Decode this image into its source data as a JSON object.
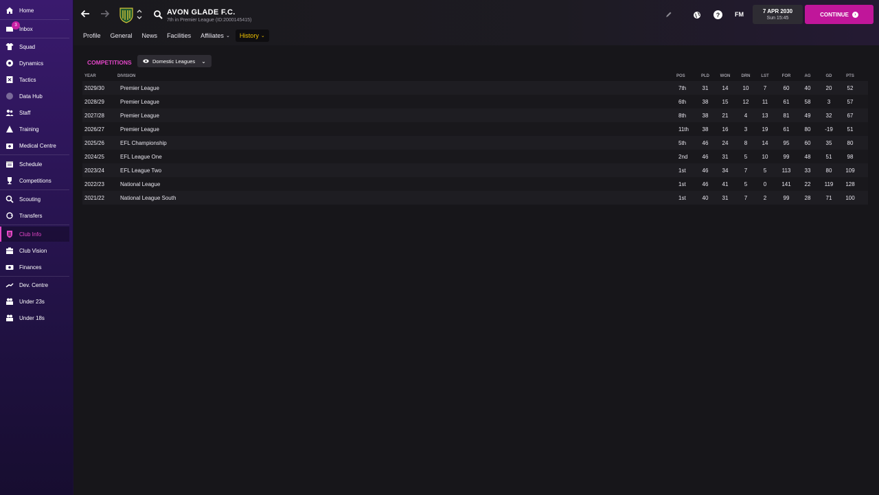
{
  "sidebar": {
    "items": [
      {
        "label": "Home",
        "icon": "home-icon"
      },
      {
        "label": "Inbox",
        "icon": "inbox-icon",
        "badge": "3"
      },
      {
        "label": "Squad",
        "icon": "shirt-icon"
      },
      {
        "label": "Dynamics",
        "icon": "dynamics-icon"
      },
      {
        "label": "Tactics",
        "icon": "tactics-icon"
      },
      {
        "label": "Data Hub",
        "icon": "data-hub-icon"
      },
      {
        "label": "Staff",
        "icon": "staff-icon"
      },
      {
        "label": "Training",
        "icon": "training-icon"
      },
      {
        "label": "Medical Centre",
        "icon": "medical-icon"
      },
      {
        "label": "Schedule",
        "icon": "calendar-icon"
      },
      {
        "label": "Competitions",
        "icon": "trophy-icon"
      },
      {
        "label": "Scouting",
        "icon": "scouting-icon"
      },
      {
        "label": "Transfers",
        "icon": "transfers-icon"
      },
      {
        "label": "Club Info",
        "icon": "club-shield-icon",
        "active": true
      },
      {
        "label": "Club Vision",
        "icon": "vision-icon"
      },
      {
        "label": "Finances",
        "icon": "finances-icon"
      },
      {
        "label": "Dev. Centre",
        "icon": "dev-centre-icon"
      },
      {
        "label": "Under 23s",
        "icon": "under23-icon"
      },
      {
        "label": "Under 18s",
        "icon": "under18-icon"
      }
    ]
  },
  "header": {
    "club_name": "AVON GLADE F.C.",
    "club_subtitle": "7th in Premier League (ID:2000145415)",
    "fm_logo": "FM",
    "help_glyph": "?",
    "date": "7 APR 2030",
    "time": "Sun 15:45",
    "continue_label": "CONTINUE"
  },
  "tabs": [
    {
      "label": "Profile"
    },
    {
      "label": "General"
    },
    {
      "label": "News"
    },
    {
      "label": "Facilities"
    },
    {
      "label": "Affiliates",
      "dropdown": true
    },
    {
      "label": "History",
      "dropdown": true,
      "active": true
    }
  ],
  "competitions": {
    "title": "COMPETITIONS",
    "filter_label": "Domestic Leagues"
  },
  "table": {
    "headers": {
      "year": "YEAR",
      "division": "DIVISION",
      "pos": "POS",
      "pld": "PLD",
      "won": "WON",
      "drn": "DRN",
      "lst": "LST",
      "for": "FOR",
      "ag": "AG",
      "gd": "GD",
      "pts": "PTS"
    },
    "rows": [
      {
        "year": "2029/30",
        "division": "Premier League",
        "pos": "7th",
        "pld": "31",
        "won": "14",
        "drn": "10",
        "lst": "7",
        "for": "60",
        "ag": "40",
        "gd": "20",
        "pts": "52"
      },
      {
        "year": "2028/29",
        "division": "Premier League",
        "pos": "6th",
        "pld": "38",
        "won": "15",
        "drn": "12",
        "lst": "11",
        "for": "61",
        "ag": "58",
        "gd": "3",
        "pts": "57"
      },
      {
        "year": "2027/28",
        "division": "Premier League",
        "pos": "8th",
        "pld": "38",
        "won": "21",
        "drn": "4",
        "lst": "13",
        "for": "81",
        "ag": "49",
        "gd": "32",
        "pts": "67"
      },
      {
        "year": "2026/27",
        "division": "Premier League",
        "pos": "11th",
        "pld": "38",
        "won": "16",
        "drn": "3",
        "lst": "19",
        "for": "61",
        "ag": "80",
        "gd": "-19",
        "pts": "51"
      },
      {
        "year": "2025/26",
        "division": "EFL Championship",
        "pos": "5th",
        "pld": "46",
        "won": "24",
        "drn": "8",
        "lst": "14",
        "for": "95",
        "ag": "60",
        "gd": "35",
        "pts": "80"
      },
      {
        "year": "2024/25",
        "division": "EFL League One",
        "pos": "2nd",
        "pld": "46",
        "won": "31",
        "drn": "5",
        "lst": "10",
        "for": "99",
        "ag": "48",
        "gd": "51",
        "pts": "98"
      },
      {
        "year": "2023/24",
        "division": "EFL League Two",
        "pos": "1st",
        "pld": "46",
        "won": "34",
        "drn": "7",
        "lst": "5",
        "for": "113",
        "ag": "33",
        "gd": "80",
        "pts": "109"
      },
      {
        "year": "2022/23",
        "division": "National League",
        "pos": "1st",
        "pld": "46",
        "won": "41",
        "drn": "5",
        "lst": "0",
        "for": "141",
        "ag": "22",
        "gd": "119",
        "pts": "128"
      },
      {
        "year": "2021/22",
        "division": "National League South",
        "pos": "1st",
        "pld": "40",
        "won": "31",
        "drn": "7",
        "lst": "2",
        "for": "99",
        "ag": "28",
        "gd": "71",
        "pts": "100"
      }
    ]
  },
  "colors": {
    "accent": "#e447c8",
    "continue": "#c0169a",
    "active_tab_text": "#f2c400"
  }
}
